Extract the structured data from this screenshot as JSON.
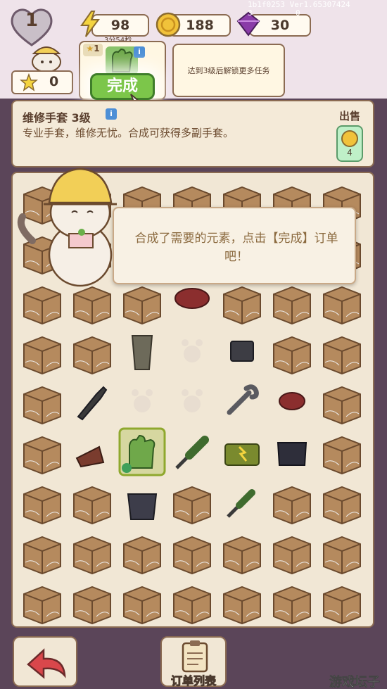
{
  "header": {
    "level": "1",
    "energy": "98",
    "energy_timer": "3分54秒",
    "coins": "188",
    "gems": "30",
    "stars": "0",
    "debug_line1": "1b1f0253 Ver1.65307424",
    "debug_line2a": "3",
    "debug_line2b": "0"
  },
  "order": {
    "badge_count": "1",
    "done_label": "完成",
    "locked_text": "达到3级后解锁更多任务"
  },
  "item_info": {
    "title": "维修手套 3级",
    "description": "专业手套，维修无忧。合成可获得多副手套。",
    "sell_label": "出售",
    "sell_price": "4"
  },
  "tutorial": {
    "text": "合成了需要的元素，点击【完成】订单吧！"
  },
  "bottom": {
    "orders_label": "订单列表"
  },
  "watermark": "游戏坛子",
  "colors": {
    "background": "#5b4559",
    "board": "#f1e7d5",
    "done_button": "#7cc64a",
    "box": "#b58a5e"
  },
  "board": {
    "columns": 7,
    "rows": 9,
    "cells": [
      "box",
      "box",
      "box",
      "box",
      "box",
      "box",
      "box",
      "box",
      "box",
      "box",
      "box",
      "box",
      "box",
      "box",
      "box",
      "box",
      "box",
      "red-blob",
      "box",
      "box",
      "box",
      "box",
      "box",
      "drink-glass",
      "empty",
      "black-box-item",
      "box",
      "box",
      "box",
      "knife",
      "empty",
      "empty",
      "wrench",
      "red-blob-small",
      "box",
      "box",
      "cake-slice",
      "gloves-selected",
      "screwdriver",
      "toolbox",
      "black-pouch",
      "box",
      "box",
      "box",
      "black-bag",
      "box",
      "screwdriver-small",
      "box",
      "box",
      "box",
      "box",
      "box",
      "box",
      "box",
      "box",
      "box",
      "box",
      "box",
      "box",
      "box",
      "box",
      "box",
      "box"
    ]
  }
}
